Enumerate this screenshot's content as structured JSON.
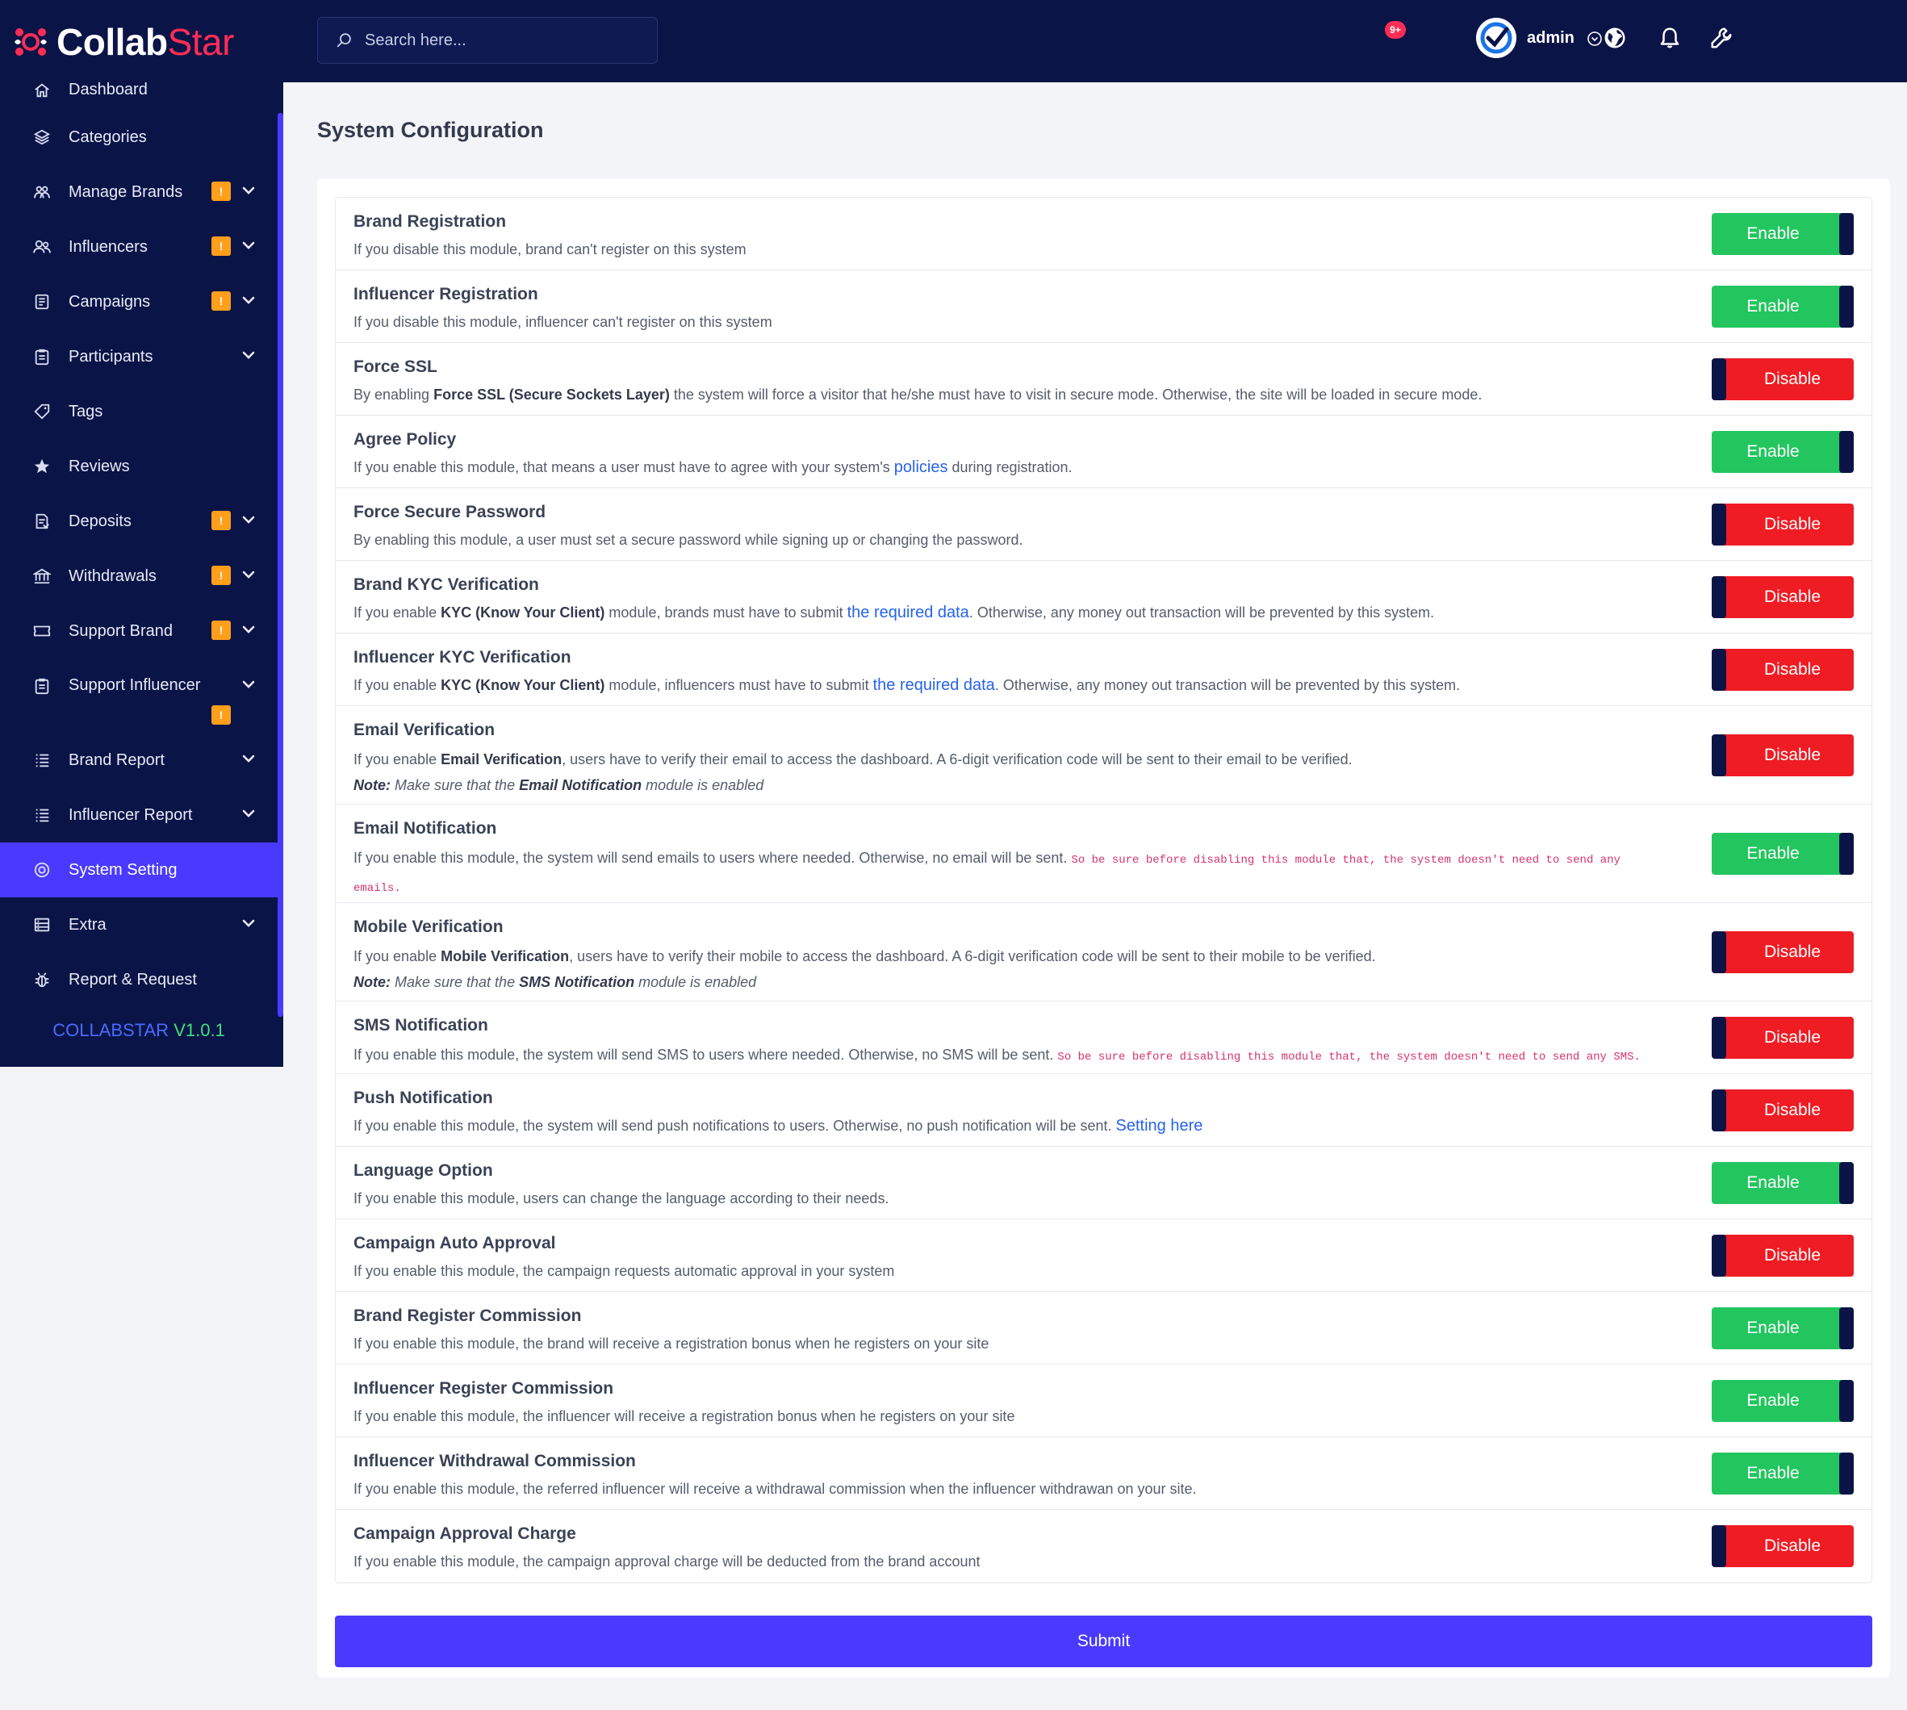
{
  "brand": {
    "part1": "Collab",
    "part2": "Star",
    "version_name": "COLLABSTAR",
    "version_num": "V1.0.1"
  },
  "search": {
    "placeholder": "Search here..."
  },
  "header": {
    "notification_count": "9+",
    "user_name": "admin"
  },
  "sidebar": {
    "items": [
      {
        "label": "Dashboard",
        "icon": "home-icon",
        "badge": "",
        "chevron": false
      },
      {
        "label": "Categories",
        "icon": "layers-icon",
        "badge": "",
        "chevron": false
      },
      {
        "label": "Manage Brands",
        "icon": "brands-icon",
        "badge": "!",
        "chevron": true
      },
      {
        "label": "Influencers",
        "icon": "users-icon",
        "badge": "!",
        "chevron": true
      },
      {
        "label": "Campaigns",
        "icon": "campaign-icon",
        "badge": "!",
        "chevron": true
      },
      {
        "label": "Participants",
        "icon": "clipboard-icon",
        "badge": "",
        "chevron": true
      },
      {
        "label": "Tags",
        "icon": "tag-icon",
        "badge": "",
        "chevron": false
      },
      {
        "label": "Reviews",
        "icon": "star-icon",
        "badge": "",
        "chevron": false
      },
      {
        "label": "Deposits",
        "icon": "deposit-icon",
        "badge": "!",
        "chevron": true
      },
      {
        "label": "Withdrawals",
        "icon": "bank-icon",
        "badge": "!",
        "chevron": true
      },
      {
        "label": "Support Brand",
        "icon": "ticket-icon",
        "badge": "!",
        "chevron": true
      },
      {
        "label": "Support Influencer",
        "icon": "clipboard-icon",
        "badge": "!",
        "chevron": true
      },
      {
        "label": "Brand Report",
        "icon": "list-icon",
        "badge": "",
        "chevron": true
      },
      {
        "label": "Influencer Report",
        "icon": "list-icon",
        "badge": "",
        "chevron": true
      },
      {
        "label": "System Setting",
        "icon": "settings-icon",
        "badge": "",
        "chevron": false,
        "active": true
      },
      {
        "label": "Extra",
        "icon": "server-icon",
        "badge": "",
        "chevron": true
      },
      {
        "label": "Report & Request",
        "icon": "bug-icon",
        "badge": "",
        "chevron": false
      }
    ]
  },
  "main": {
    "title": "System Configuration",
    "submit_label": "Submit",
    "enable_label": "Enable",
    "disable_label": "Disable",
    "rows": [
      {
        "title": "Brand Registration",
        "state": "Enable",
        "desc": [
          "If you disable this module, brand can't register on this system"
        ]
      },
      {
        "title": "Influencer Registration",
        "state": "Enable",
        "desc": [
          "If you disable this module, influencer can't register on this system"
        ]
      },
      {
        "title": "Force SSL",
        "state": "Disable",
        "desc": [
          "By enabling ",
          "Force SSL (Secure Sockets Layer)",
          " the system will force a visitor that he/she must have to visit in secure mode. Otherwise, the site will be loaded in secure mode."
        ]
      },
      {
        "title": "Agree Policy",
        "state": "Enable",
        "desc": [
          "If you enable this module, that means a user must have to agree with your system's ",
          "policies",
          " during registration."
        ]
      },
      {
        "title": "Force Secure Password",
        "state": "Disable",
        "desc": [
          "By enabling this module, a user must set a secure password while signing up or changing the password."
        ]
      },
      {
        "title": "Brand KYC Verification",
        "state": "Disable",
        "desc": [
          "If you enable ",
          "KYC (Know Your Client)",
          " module, brands must have to submit ",
          "the required data",
          ". Otherwise, any money out transaction will be prevented by this system."
        ]
      },
      {
        "title": "Influencer KYC Verification",
        "state": "Disable",
        "desc": [
          "If you enable ",
          "KYC (Know Your Client)",
          " module, influencers must have to submit ",
          "the required data",
          ". Otherwise, any money out transaction will be prevented by this system."
        ]
      },
      {
        "title": "Email Verification",
        "state": "Disable",
        "desc": [
          "If you enable ",
          "Email Verification",
          ", users have to verify their email to access the dashboard. A 6-digit verification code will be sent to their email to be verified."
        ],
        "note": [
          "Note:",
          " Make sure that the ",
          "Email Notification",
          " module is enabled"
        ]
      },
      {
        "title": "Email Notification",
        "state": "Enable",
        "desc": [
          "If you enable this module, the system will send emails to users where needed. Otherwise, no email will be sent. ",
          "So be sure before disabling this module that, the system doesn't need to send any emails."
        ]
      },
      {
        "title": "Mobile Verification",
        "state": "Disable",
        "desc": [
          "If you enable ",
          "Mobile Verification",
          ", users have to verify their mobile to access the dashboard. A 6-digit verification code will be sent to their mobile to be verified."
        ],
        "note": [
          "Note:",
          " Make sure that the ",
          "SMS Notification",
          " module is enabled"
        ]
      },
      {
        "title": "SMS Notification",
        "state": "Disable",
        "desc": [
          "If you enable this module, the system will send SMS to users where needed. Otherwise, no SMS will be sent. ",
          "So be sure before disabling this module that, the system doesn't need to send any SMS."
        ]
      },
      {
        "title": "Push Notification",
        "state": "Disable",
        "desc": [
          "If you enable this module, the system will send push notifications to users. Otherwise, no push notification will be sent. ",
          "Setting here"
        ]
      },
      {
        "title": "Language Option",
        "state": "Enable",
        "desc": [
          "If you enable this module, users can change the language according to their needs."
        ]
      },
      {
        "title": "Campaign Auto Approval",
        "state": "Disable",
        "desc": [
          "If you enable this module, the campaign requests automatic approval in your system"
        ]
      },
      {
        "title": "Brand Register Commission",
        "state": "Enable",
        "desc": [
          "If you enable this module, the brand will receive a registration bonus when he registers on your site"
        ]
      },
      {
        "title": "Influencer Register Commission",
        "state": "Enable",
        "desc": [
          "If you enable this module, the influencer will receive a registration bonus when he registers on your site"
        ]
      },
      {
        "title": "Influencer Withdrawal Commission",
        "state": "Enable",
        "desc": [
          "If you enable this module, the referred influencer will receive a withdrawal commission when the influencer withdrawan on your site."
        ]
      },
      {
        "title": "Campaign Approval Charge",
        "state": "Disable",
        "desc": [
          "If you enable this module, the campaign approval charge will be deducted from the brand account"
        ]
      }
    ]
  },
  "colors": {
    "navy": "#0b1447",
    "accent": "#4a3aff",
    "enable": "#22c55e",
    "disable": "#ef1c24",
    "badge": "#ff9f1c",
    "brand_red": "#ff2d55"
  }
}
